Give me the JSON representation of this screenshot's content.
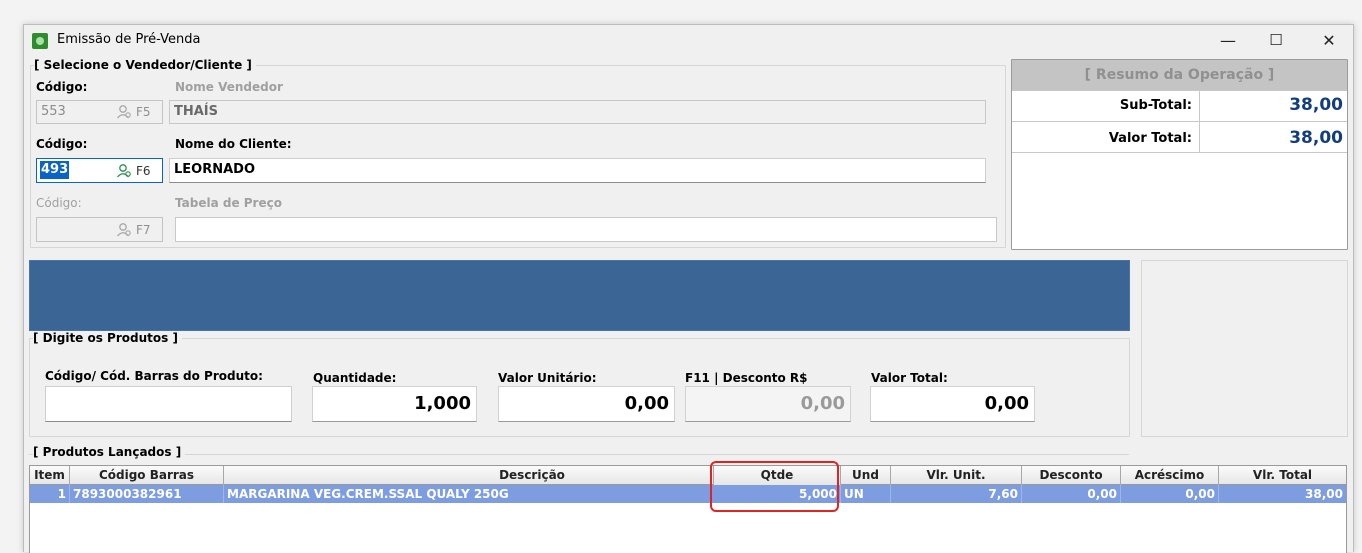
{
  "window": {
    "title": "Emissão de Pré-Venda",
    "minimize": "—",
    "maximize": "☐",
    "close": "✕"
  },
  "vendedor_cliente": {
    "group_title": "[ Selecione o Vendedor/Cliente ]",
    "vendedor": {
      "code_label": "Código:",
      "name_label": "Nome Vendedor",
      "code": "553",
      "fkey": "F5",
      "name": "THAÍS"
    },
    "cliente": {
      "code_label": "Código:",
      "name_label": "Nome do Cliente:",
      "code": "493",
      "fkey": "F6",
      "name": "LEORNADO"
    },
    "tabela": {
      "code_label": "Código:",
      "name_label": "Tabela de Preço",
      "code": "",
      "fkey": "F7",
      "name": ""
    }
  },
  "resumo": {
    "title": "[ Resumo da Operação ]",
    "subtotal_label": "Sub-Total:",
    "subtotal_value": "38,00",
    "total_label": "Valor Total:",
    "total_value": "38,00"
  },
  "produtos": {
    "group_title": "[ Digite os Produtos ]",
    "codigo_label": "Código/ Cód. Barras do Produto:",
    "codigo_value": "",
    "quantidade_label": "Quantidade:",
    "quantidade_value": "1,000",
    "valor_unitario_label": "Valor Unitário:",
    "valor_unitario_value": "0,00",
    "desconto_label": "F11 | Desconto R$",
    "desconto_value": "0,00",
    "valor_total_label": "Valor Total:",
    "valor_total_value": "0,00"
  },
  "lancados": {
    "group_title": "[ Produtos Lançados ]",
    "columns": [
      "Item",
      "Código Barras",
      "Descrição",
      "Qtde",
      "Und",
      "Vlr. Unit.",
      "Desconto",
      "Acréscimo",
      "Vlr. Total"
    ],
    "rows": [
      [
        "1",
        "7893000382961",
        "MARGARINA VEG.CREM.SSAL QUALY 250G",
        "5,000",
        "UN",
        "7,60",
        "0,00",
        "0,00",
        "38,00"
      ]
    ]
  },
  "colors": {
    "banner": "#3a6595",
    "selected_row": "#7e9de0",
    "summary_value": "#123e7a",
    "highlight": "#e02424"
  }
}
